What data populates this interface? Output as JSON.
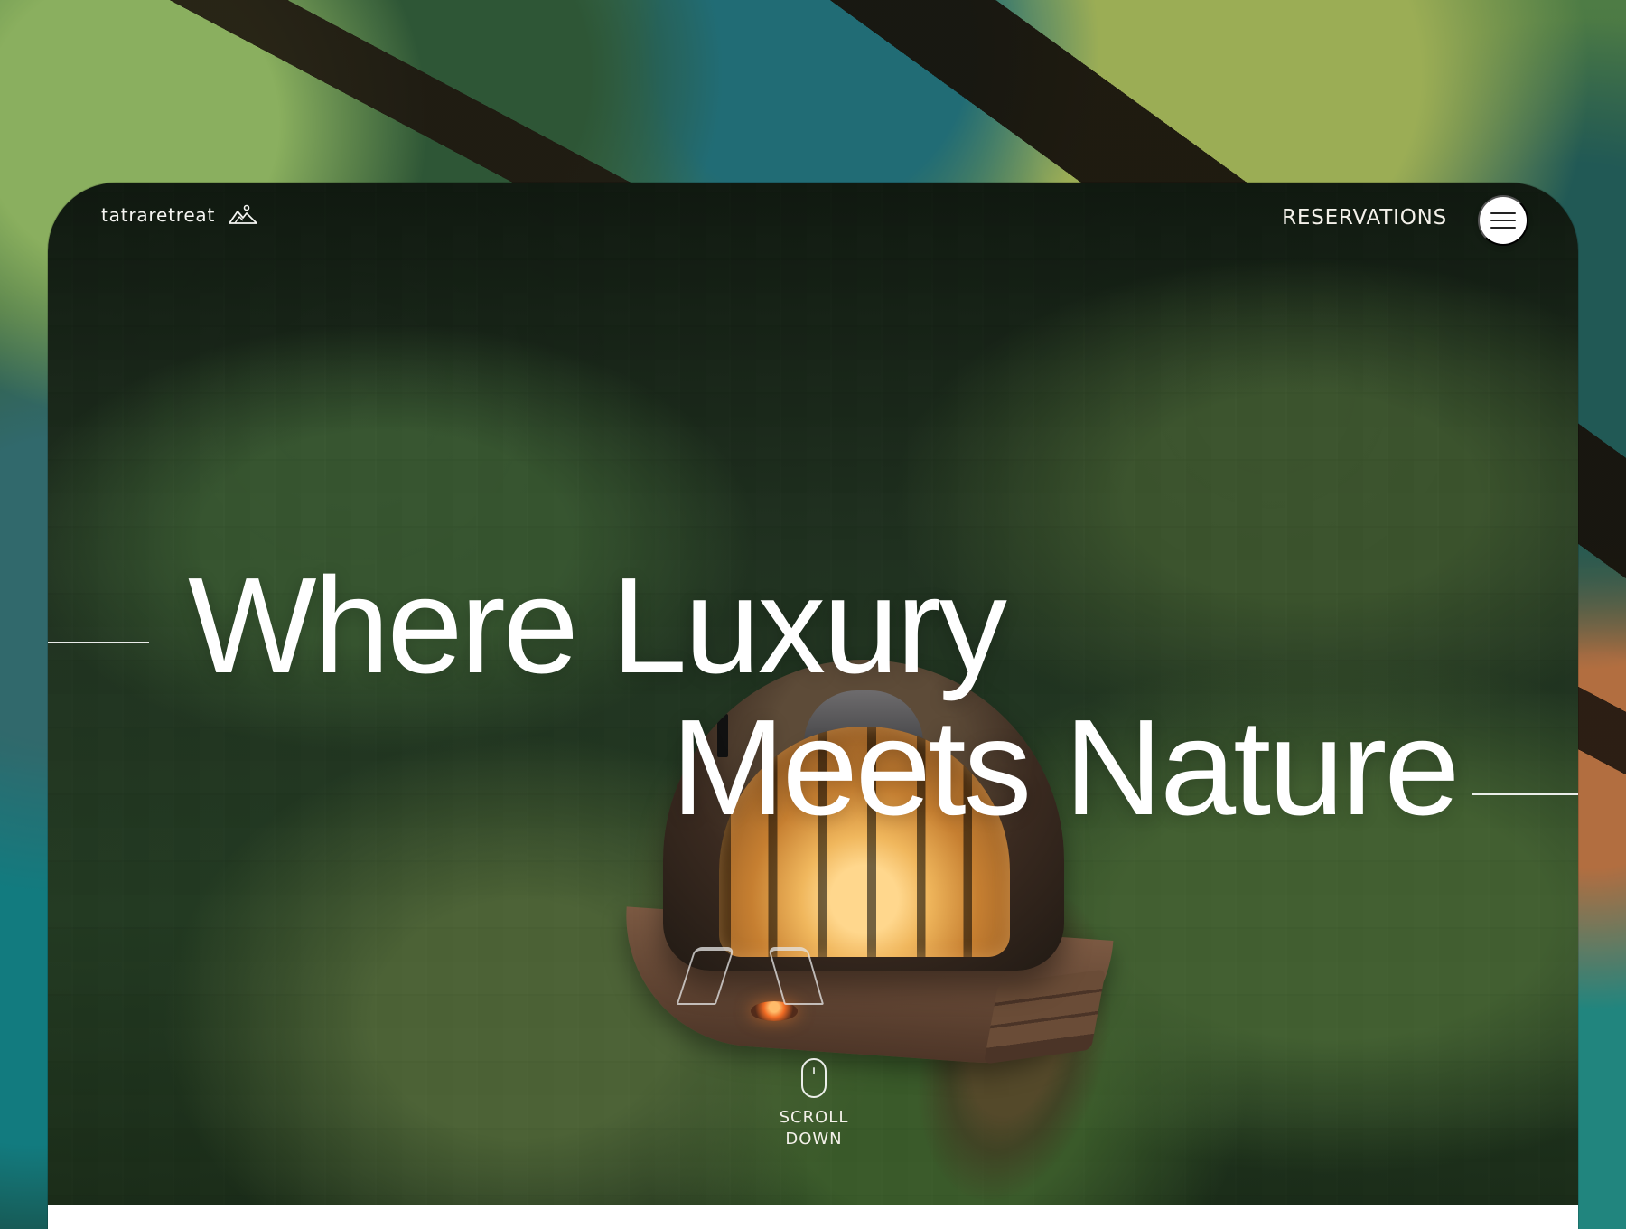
{
  "brand": {
    "name": "tatraretreat",
    "icon": "mountain-icon"
  },
  "header": {
    "reservations_label": "RESERVATIONS",
    "menu_icon": "menu-icon"
  },
  "hero": {
    "title_line_1": "Where Luxury",
    "title_line_2": "Meets Nature"
  },
  "scroll": {
    "line_1": "SCROLL",
    "line_2": "DOWN",
    "icon": "mouse-icon"
  },
  "colors": {
    "primary_text": "#ffffff",
    "menu_button_bg": "#ffffff",
    "menu_icon_color": "#222222"
  }
}
